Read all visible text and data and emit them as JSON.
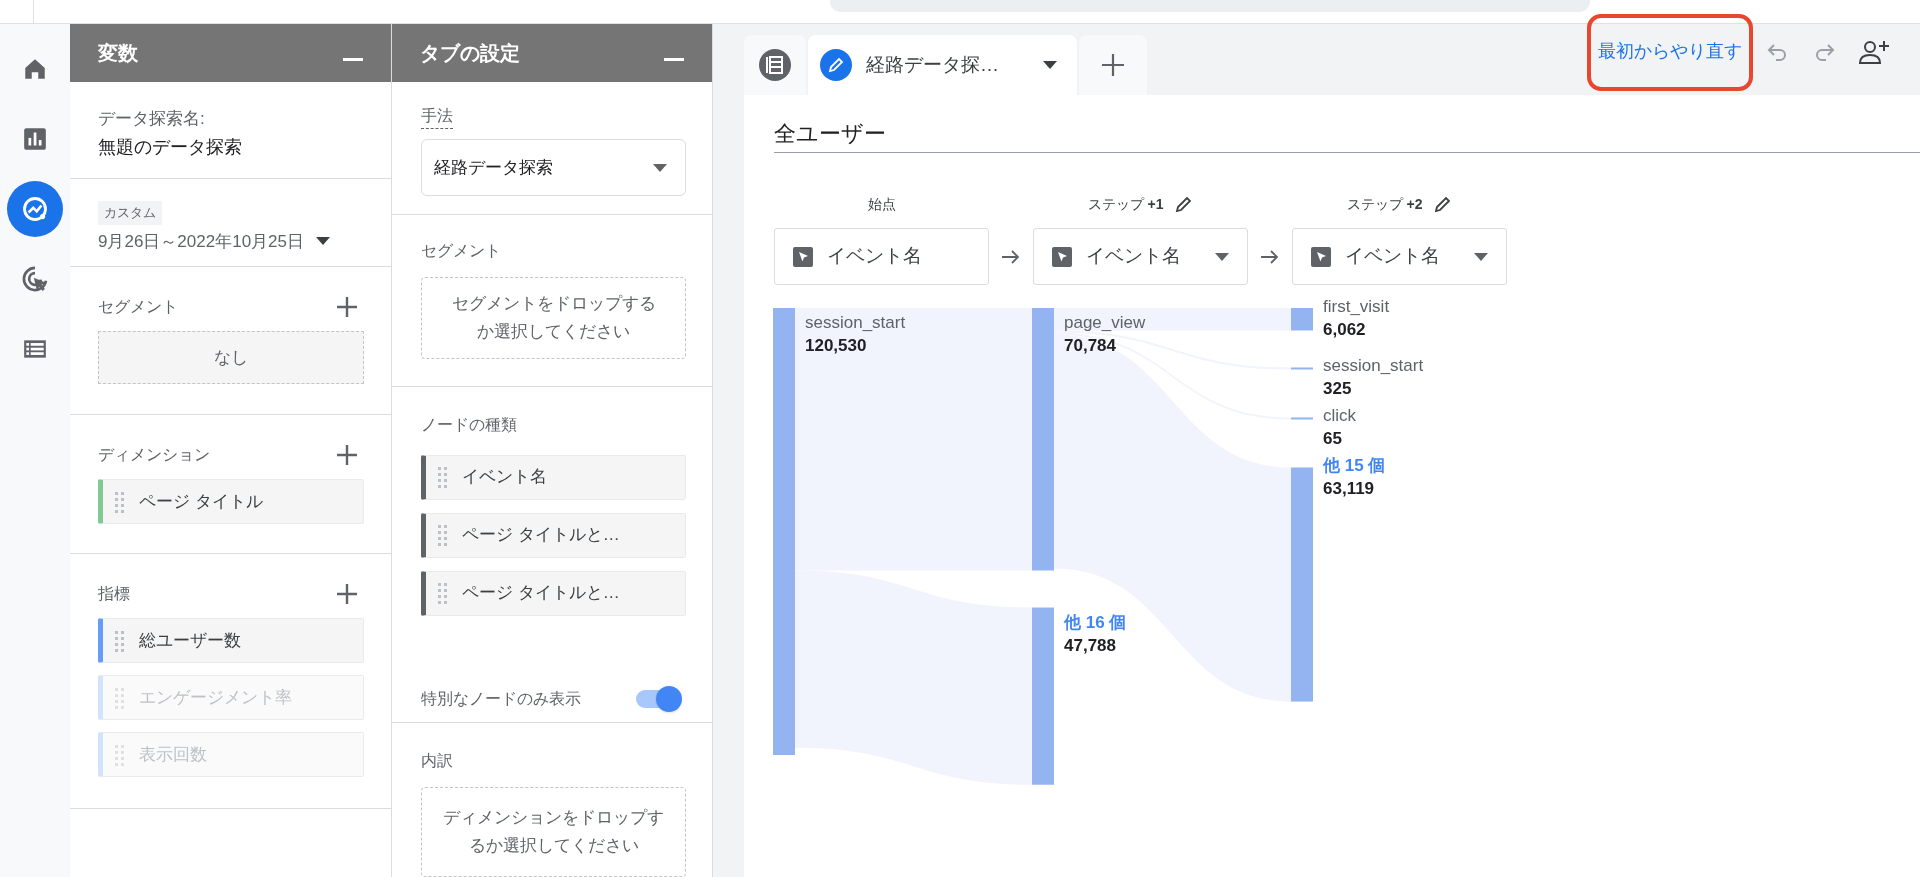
{
  "rail": [
    {
      "kind": "home",
      "selected": false
    },
    {
      "kind": "reports",
      "selected": false
    },
    {
      "kind": "explore",
      "selected": true
    },
    {
      "kind": "advertising",
      "selected": false
    },
    {
      "kind": "configure",
      "selected": false
    }
  ],
  "variables_panel": {
    "title": "変数",
    "exploration_name_label": "データ探索名:",
    "exploration_name": "無題のデータ探索",
    "date_range": {
      "badge": "カスタム",
      "value": "9月26日～2022年10月25日"
    },
    "sections": [
      {
        "kind": "segment",
        "title": "セグメント",
        "placeholder": "なし"
      },
      {
        "kind": "dimension",
        "title": "ディメンション",
        "items": [
          {
            "label": "ページ タイトル",
            "enabled": true
          }
        ]
      },
      {
        "kind": "metric",
        "title": "指標",
        "items": [
          {
            "label": "総ユーザー数",
            "enabled": true
          },
          {
            "label": "エンゲージメント率",
            "enabled": false
          },
          {
            "label": "表示回数",
            "enabled": false
          }
        ]
      }
    ]
  },
  "tab_settings_panel": {
    "title": "タブの設定",
    "technique": {
      "label": "手法",
      "value": "経路データ探索"
    },
    "segment": {
      "label": "セグメント",
      "drop_hint": "セグメントをドロップするか選択してください"
    },
    "node_types": {
      "label": "ノードの種類",
      "items": [
        "イベント名",
        "ページ タイトルと…",
        "ページ タイトルと…"
      ]
    },
    "special_nodes_toggle": {
      "label": "特別なノードのみ表示",
      "on": true
    },
    "breakdown": {
      "label": "内訳",
      "drop_hint": "ディメンションをドロップするか選択してください"
    }
  },
  "tabs": [
    {
      "label": "経路データ探…",
      "selected": true
    }
  ],
  "restart": {
    "label": "最初からやり直す",
    "highlighted": true
  },
  "segment_title": "全ユーザー",
  "path_chart": {
    "columns": [
      {
        "header": "始点",
        "editable": false,
        "dropdown": {
          "label": "イベント名",
          "has_caret": false
        },
        "nodes": [
          {
            "label": "session_start",
            "value": "120,530",
            "kind": "event"
          }
        ]
      },
      {
        "header": "ステップ **+1**",
        "editable": true,
        "dropdown": {
          "label": "イベント名",
          "has_caret": true
        },
        "nodes": [
          {
            "label": "page_view",
            "value": "70,784",
            "kind": "event"
          },
          {
            "label": "他 16 個",
            "value": "47,788",
            "kind": "other"
          }
        ]
      },
      {
        "header": "ステップ **+2**",
        "editable": true,
        "dropdown": {
          "label": "イベント名",
          "has_caret": true
        },
        "nodes": [
          {
            "label": "first_visit",
            "value": "6,062",
            "kind": "event"
          },
          {
            "label": "session_start",
            "value": "325",
            "kind": "event"
          },
          {
            "label": "click",
            "value": "65",
            "kind": "event"
          },
          {
            "label": "他 15 個",
            "value": "63,119",
            "kind": "other"
          }
        ]
      }
    ]
  }
}
